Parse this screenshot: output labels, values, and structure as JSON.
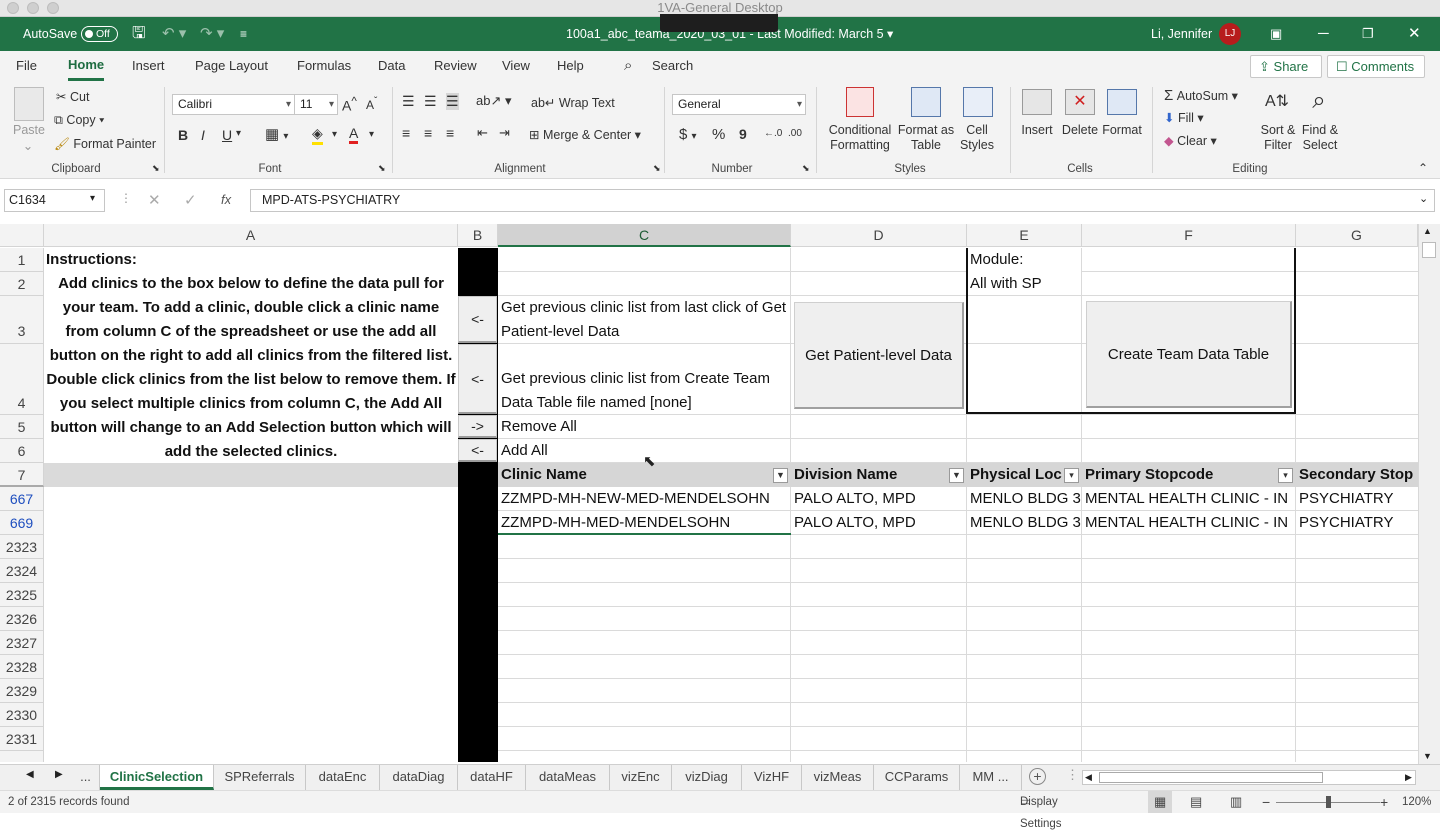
{
  "window": {
    "mac_title": "1VA-General Desktop"
  },
  "titlebar": {
    "autosave_label": "AutoSave",
    "autosave_state": "Off",
    "file_title": "100a1_abc_teama_2020_03_01 - Last Modified: March 5 ▾",
    "user_name": "Li, Jennifer",
    "user_initials": "LJ"
  },
  "menu": {
    "items": [
      "File",
      "Home",
      "Insert",
      "Page Layout",
      "Formulas",
      "Data",
      "Review",
      "View",
      "Help"
    ],
    "search": "Search",
    "share": "Share",
    "comments": "Comments"
  },
  "ribbon": {
    "clipboard": {
      "paste": "Paste",
      "cut": "Cut",
      "copy": "Copy",
      "format_painter": "Format Painter",
      "group": "Clipboard"
    },
    "font": {
      "name": "Calibri",
      "size": "11",
      "bold": "B",
      "italic": "I",
      "underline": "U",
      "group": "Font"
    },
    "alignment": {
      "wrap": "Wrap Text",
      "merge": "Merge & Center",
      "group": "Alignment"
    },
    "number": {
      "format": "General",
      "currency": "$",
      "percent": "%",
      "comma": "9",
      "group": "Number"
    },
    "styles": {
      "conditional": "Conditional Formatting",
      "format_table": "Format as Table",
      "cell_styles": "Cell Styles",
      "group": "Styles"
    },
    "cells": {
      "insert": "Insert",
      "delete": "Delete",
      "format": "Format",
      "group": "Cells"
    },
    "editing": {
      "autosum": "AutoSum",
      "fill": "Fill",
      "clear": "Clear",
      "sort": "Sort & Filter",
      "find": "Find & Select",
      "group": "Editing"
    }
  },
  "formula": {
    "namebox": "C1634",
    "fx": "fx",
    "value": "MPD-ATS-PSYCHIATRY"
  },
  "columns": [
    "A",
    "B",
    "C",
    "D",
    "E",
    "F",
    "G"
  ],
  "rows": [
    "1",
    "2",
    "3",
    "4",
    "5",
    "6",
    "7",
    "667",
    "669",
    "2323",
    "2324",
    "2325",
    "2326",
    "2327",
    "2328",
    "2329",
    "2330",
    "2331"
  ],
  "sheet": {
    "instructions_title": "Instructions:",
    "instructions_body": "Add clinics to the box below to define the data pull for your team. To add a clinic, double click a clinic name from column C of the spreadsheet or use the add all button on the right to add all clinics from the filtered list. Double click clinics from the list below to remove them. If you select multiple clinics from column C, the Add All button will change to an Add Selection button which will add the selected clinics.",
    "arrow_left": "<-",
    "arrow_right": "->",
    "prev_last_click": "Get previous clinic list from last click of Get Patient-level Data",
    "prev_create": "Get previous clinic list from Create Team Data Table file named [none]",
    "remove_all": "Remove All",
    "add_all": "Add All",
    "module_label": "Module:",
    "module_value": "All with SP",
    "btn_patient": "Get Patient-level Data",
    "btn_team": "Create Team Data Table",
    "headers": [
      "Clinic Name",
      "Division Name",
      "Physical Loca",
      "Primary Stopcode",
      "Secondary Stop"
    ],
    "data_rows": [
      [
        "ZZMPD-MH-NEW-MED-MENDELSOHN",
        "PALO ALTO, MPD",
        "MENLO BLDG 3",
        "MENTAL HEALTH CLINIC - IN",
        "PSYCHIATRY"
      ],
      [
        "ZZMPD-MH-MED-MENDELSOHN",
        "PALO ALTO, MPD",
        "MENLO BLDG 3",
        "MENTAL HEALTH CLINIC - IN",
        "PSYCHIATRY"
      ]
    ]
  },
  "tabs": [
    "...",
    "ClinicSelection",
    "SPReferrals",
    "dataEnc",
    "dataDiag",
    "dataHF",
    "dataMeas",
    "vizEnc",
    "vizDiag",
    "VizHF",
    "vizMeas",
    "CCParams",
    "MM ..."
  ],
  "status": {
    "records": "2 of 2315 records found",
    "display_settings": "Display Settings",
    "zoom": "120%"
  },
  "colors": {
    "excel_green": "#217346",
    "avatar": "#b71c1c"
  }
}
